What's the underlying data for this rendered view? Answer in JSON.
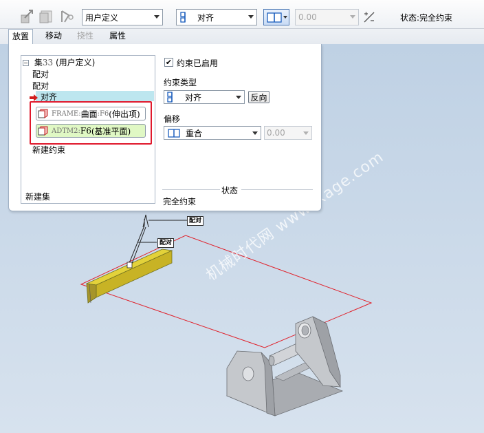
{
  "toolbar": {
    "set_type": "用户定义",
    "constraint": "对齐",
    "offset_value": "0.00",
    "status": "状态:完全约束"
  },
  "tabs": [
    {
      "label": "放置",
      "active": true
    },
    {
      "label": "移动"
    },
    {
      "label": "挠性",
      "disabled": true
    },
    {
      "label": "属性"
    }
  ],
  "panel": {
    "tree": {
      "set_label": "集",
      "set_number": "33",
      "set_paren": "(用户定义)",
      "items": [
        "配对",
        "配对",
        "对齐"
      ],
      "refs": [
        {
          "prefix": "FRAME:",
          "main": "曲面",
          "suffix": ":F6",
          "detail": "(伸出项)"
        },
        {
          "prefix": "ADTM2:",
          "main": "F6",
          "suffix": "",
          "detail": "(基准平面)"
        }
      ],
      "new_constraint": "新建约束",
      "new_set": "新建集"
    },
    "enabled_label": "约束已启用",
    "enabled": true,
    "type_label": "约束类型",
    "type_value": "对齐",
    "flip_label": "反向",
    "offset_label": "偏移",
    "offset_value": "重合",
    "offset_num": "0.00",
    "status_header": "状态",
    "status_value": "完全约束"
  },
  "viewport": {
    "tag1": "配对",
    "tag2": "配对",
    "watermark1": "机械时代网",
    "watermark2": "www.jxage.com"
  }
}
